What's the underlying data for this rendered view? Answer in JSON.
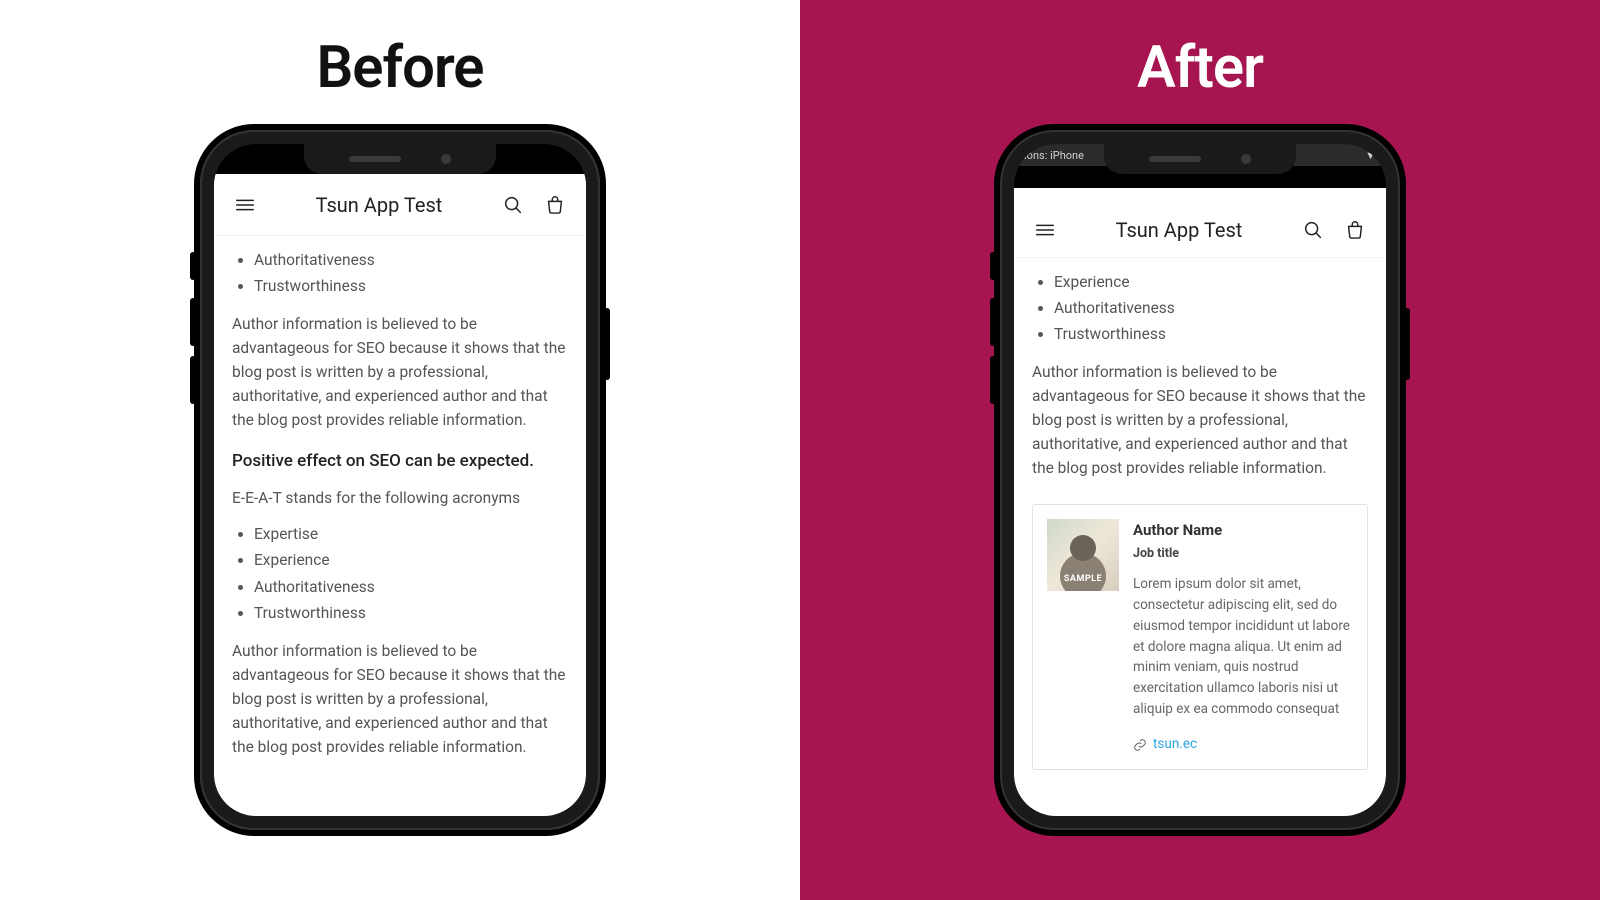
{
  "labels": {
    "before": "Before",
    "after": "After"
  },
  "colors": {
    "after_bg": "#a6154f",
    "link": "#2aa7e0"
  },
  "devbar": {
    "device_text": "ions: iPhone",
    "dropdown_glyph": "▼"
  },
  "app": {
    "title": "Tsun App Test"
  },
  "article": {
    "bullets_full": [
      "Expertise",
      "Experience",
      "Authoritativeness",
      "Trustworthiness"
    ],
    "bullets_before_top": [
      "Authoritativeness",
      "Trustworthiness"
    ],
    "bullets_after_top": [
      "Experience",
      "Authoritativeness",
      "Trustworthiness"
    ],
    "paragraph": "Author information is believed to be advantageous for SEO because it shows that the blog post is written by a professional, authoritative, and experienced author and that the blog post provides reliable information.",
    "subhead": "Positive effect on SEO can be expected.",
    "acronym_line": "E-E-A-T stands for the following acronyms"
  },
  "author": {
    "photo_badge": "SAMPLE",
    "name": "Author Name",
    "job": "Job title",
    "bio": "Lorem ipsum dolor sit amet, consectetur adipiscing elit, sed do eiusmod tempor incididunt ut labore et dolore magna aliqua. Ut enim ad minim veniam, quis nostrud exercitation ullamco laboris nisi ut aliquip ex ea commodo consequat",
    "link_text": "tsun.ec"
  }
}
